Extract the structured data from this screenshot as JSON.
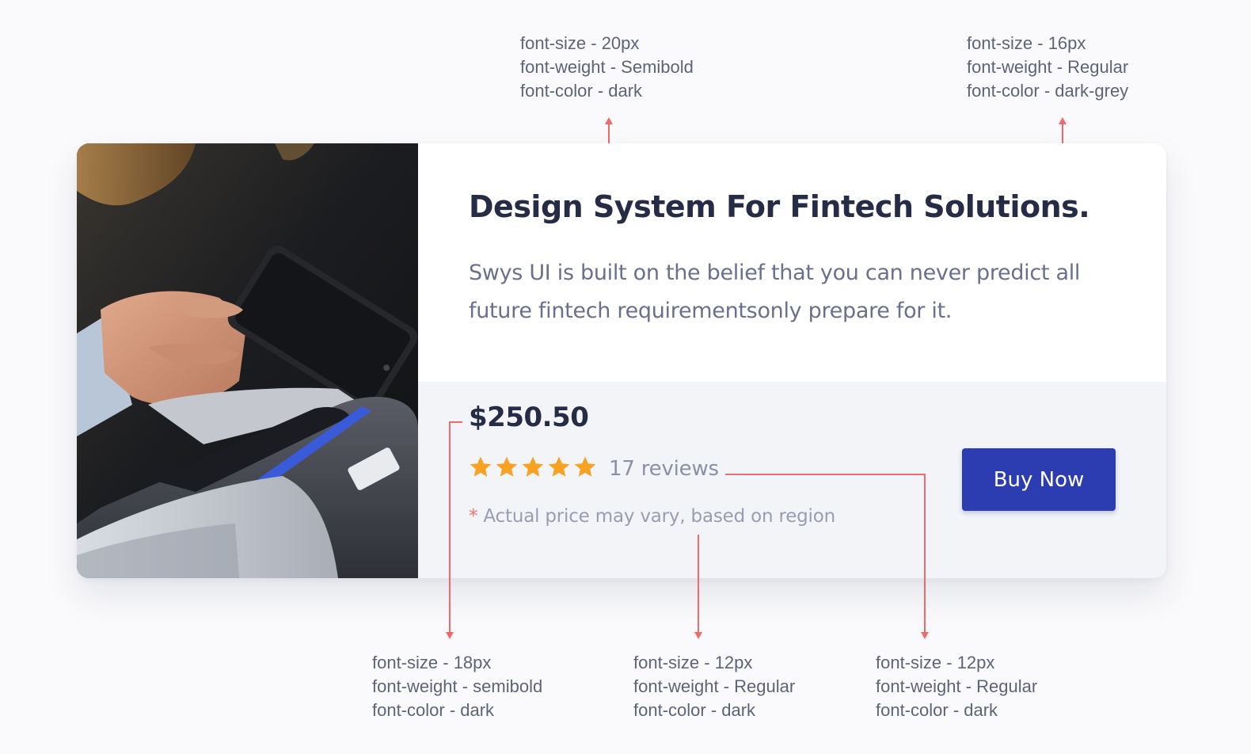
{
  "annotations": {
    "title_spec": [
      "font-size - 20px",
      "font-weight - Semibold",
      "font-color - dark"
    ],
    "desc_spec": [
      "font-size - 16px",
      "font-weight - Regular",
      "font-color - dark-grey"
    ],
    "price_spec": [
      "font-size - 18px",
      "font-weight - semibold",
      "font-color - dark"
    ],
    "note_spec": [
      "font-size - 12px",
      "font-weight - Regular",
      "font-color - dark"
    ],
    "reviews_spec": [
      "font-size - 12px",
      "font-weight - Regular",
      "font-color - dark"
    ]
  },
  "card": {
    "title": "Design System For Fintech Solutions.",
    "description": "Swys UI is built on the belief that you can never predict all future fintech requirementsonly prepare for it.",
    "price": "$250.50",
    "rating": 5,
    "rating_max": 5,
    "reviews": "17 reviews",
    "note_asterisk": "*",
    "note_text": " Actual price may vary, based on region",
    "buy_label": "Buy Now",
    "image_icon": "card-payment-photo"
  },
  "colors": {
    "accent": "#2b3db0",
    "title": "#262b46",
    "body": "#6b6f8c",
    "star": "#f7a223",
    "annotation_arrow": "#ef6a6a",
    "footer_bg": "#f2f4f7"
  }
}
